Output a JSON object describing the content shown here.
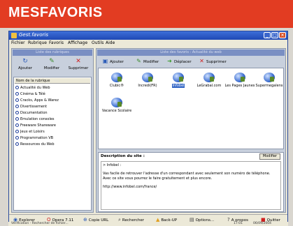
{
  "banner": {
    "title": "MESFAVORIS"
  },
  "window": {
    "title": "Gest.favoris",
    "buttons": {
      "minimize": "_",
      "maximize": "□",
      "close": "×"
    }
  },
  "menu": [
    "Fichier",
    "Rubrique",
    "Favoris",
    "Affichage",
    "Outils",
    "Aide"
  ],
  "left_panel": {
    "header": "Liste des rubriques",
    "toolbar": [
      {
        "label": "Ajouter",
        "icon": "refresh-icon"
      },
      {
        "label": "Modifier",
        "icon": "edit-icon"
      },
      {
        "label": "Supprimer",
        "icon": "delete-icon"
      }
    ],
    "tree_header": "Nom de la rubrique",
    "items": [
      "Actualité du Web",
      "Cinéma & Télé",
      "Cracks, Apps & Warez",
      "Divertissement",
      "Documentation",
      "Emulation consoles",
      "Freeware Shareware",
      "Jeux et Loisirs",
      "Programmation VB",
      "Ressources du Web"
    ],
    "selected_index": 0
  },
  "right_panel": {
    "header": "Liste des favoris : Actualité du web",
    "toolbar": [
      {
        "label": "Ajouter",
        "icon": "add-icon"
      },
      {
        "label": "Modifier",
        "icon": "edit-icon"
      },
      {
        "label": "Déplacer",
        "icon": "move-icon"
      },
      {
        "label": "Supprimer",
        "icon": "delete-icon"
      }
    ],
    "favorites": [
      {
        "label": "Clubic®"
      },
      {
        "label": "Incredi(FR)"
      },
      {
        "label": "Infobel",
        "selected": true
      },
      {
        "label": "LeGrabal.com"
      },
      {
        "label": "Les Pages Jaunes"
      },
      {
        "label": "Supermegalens"
      },
      {
        "label": "Vacance Scolaire"
      }
    ],
    "description": {
      "title": "Description du site :",
      "edit_button": "Modifier",
      "lines": [
        "> Infobel :",
        "Vas facile de retrouver l'adresse d'un correspondant avec seulement son numéro de téléphone. Avec ce site vous pourrez le faire gratuitement et plus encore.",
        "http://www.infobel.com/france/"
      ]
    }
  },
  "bottom_bar": [
    {
      "label": "Explorer",
      "icon": "globe-icon"
    },
    {
      "label": "Opera 7.11",
      "icon": "opera-icon"
    },
    {
      "label": "Copie URL",
      "icon": "copy-icon"
    },
    {
      "label": "Rechercher",
      "icon": "search-icon"
    },
    {
      "label": "Back-UP",
      "icon": "backup-icon"
    },
    {
      "label": "Options...",
      "icon": "options-icon"
    },
    {
      "label": "A propos",
      "icon": "about-icon"
    },
    {
      "label": "Quitter",
      "icon": "quit-icon"
    }
  ],
  "status": {
    "left": "Vérification - Rechercher de fichier...",
    "time": "17:01",
    "date": "06/09/2004"
  }
}
